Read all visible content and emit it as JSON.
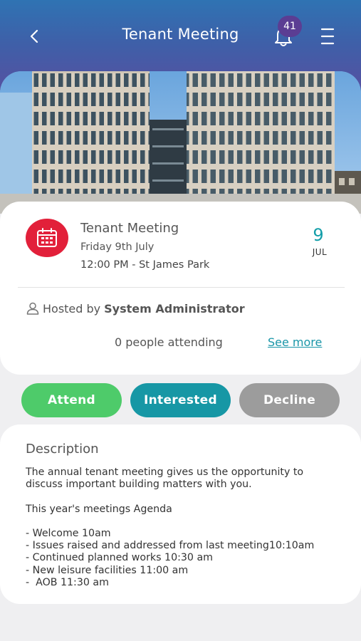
{
  "header": {
    "title": "Tenant Meeting",
    "notification_count": "41",
    "gradient_colors": [
      "#2f73b3",
      "#5a4ea0"
    ]
  },
  "event": {
    "title": "Tenant Meeting",
    "date_text": "Friday 9th July",
    "time_location": "12:00 PM - St James Park",
    "day": "9",
    "month": "JUL",
    "host_prefix": "Hosted by",
    "host_name": "System Administrator",
    "attending_text": "0 people attending",
    "see_more_label": "See more",
    "accent_color": "#139ea9",
    "calendar_color": "#e2203a"
  },
  "actions": {
    "attend_label": "Attend",
    "interested_label": "Interested",
    "decline_label": "Decline",
    "colors": {
      "attend": "#4ecb6a",
      "interested": "#1797a5",
      "decline": "#9c9c9c"
    }
  },
  "description": {
    "heading": "Description",
    "body": "The annual tenant meeting gives us the opportunity to discuss important building matters with you.\n\nThis year's meetings Agenda\n\n- Welcome 10am\n- Issues raised and addressed from last meeting10:10am\n- Continued planned works 10:30 am\n- New leisure facilities 11:00 am\n-  AOB 11:30 am"
  },
  "icons": [
    "back-arrow-icon",
    "bell-icon",
    "menu-icon",
    "calendar-icon",
    "person-icon"
  ]
}
